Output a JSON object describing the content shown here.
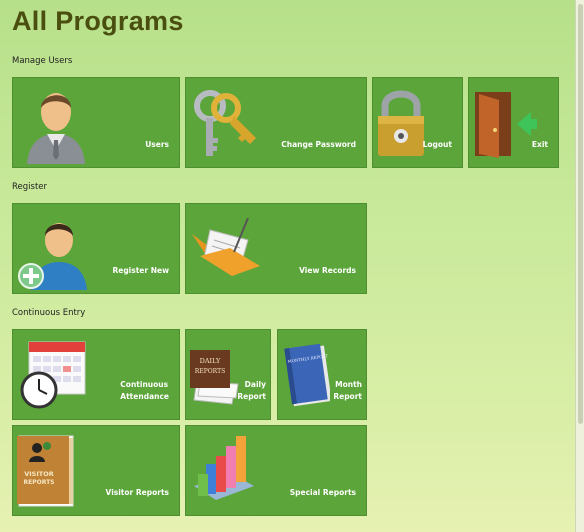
{
  "title": "All Programs",
  "sections": {
    "manage_users": "Manage Users",
    "register": "Register",
    "continuous_entry": "Continuous Entry"
  },
  "tiles": {
    "users": "Users",
    "change_password": "Change Password",
    "logout": "Logout",
    "exit": "Exit",
    "register_new": "Register New",
    "view_records": "View Records",
    "continuous_attendance_line1": "Continuous",
    "continuous_attendance_line2": "Attendance",
    "daily_report_line1": "Daily",
    "daily_report_line2": "Report",
    "month_report_line1": "Month",
    "month_report_line2": "Report",
    "visitor_reports": "Visitor Reports",
    "special_reports": "Special Reports"
  },
  "icon_text": {
    "daily_reports_line1": "DAILY",
    "daily_reports_line2": "REPORTS",
    "monthly_report": "MONTHLY REPORT",
    "visitor_reports_line1": "VISITOR",
    "visitor_reports_line2": "REPORTS"
  },
  "icons": [
    "user-icon",
    "keys-icon",
    "padlock-icon",
    "exit-door-icon",
    "register-user-icon",
    "folder-icon",
    "calendar-clock-icon",
    "daily-reports-icon",
    "monthly-report-icon",
    "visitor-reports-icon",
    "bar-chart-icon"
  ],
  "colors": {
    "tile": "#5ca53a",
    "title": "#4a4f10"
  }
}
